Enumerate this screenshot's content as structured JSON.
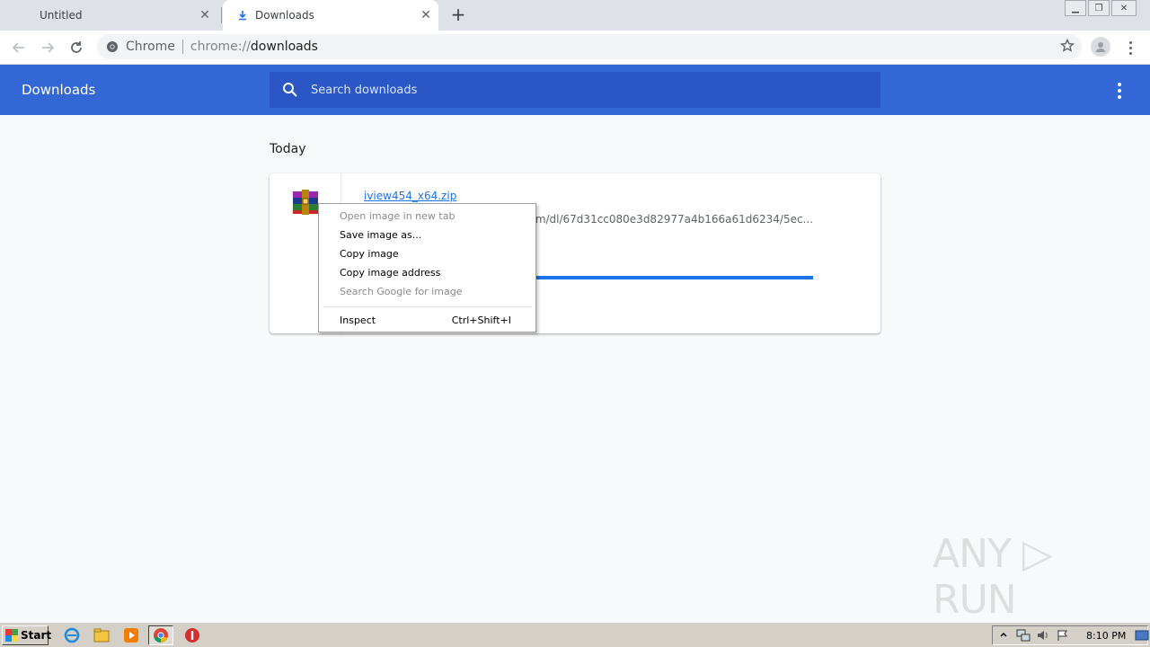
{
  "tabs": [
    {
      "label": "Untitled",
      "active": false
    },
    {
      "label": "Downloads",
      "active": true
    }
  ],
  "omnibox": {
    "chip_label": "Chrome",
    "url_scheme": "chrome://",
    "url_host": "downloads"
  },
  "downloads": {
    "title": "Downloads",
    "search_placeholder": "Search downloads",
    "section_label": "Today",
    "item": {
      "file_name": "iview454_x64.zip",
      "url": "com/dl/67d31cc080e3d82977a4b166a61d6234/5ec...",
      "progress": 1.0
    }
  },
  "context_menu": {
    "items": [
      {
        "label": "Open image in new tab",
        "disabled": true
      },
      {
        "label": "Save image as...",
        "disabled": false
      },
      {
        "label": "Copy image",
        "disabled": false
      },
      {
        "label": "Copy image address",
        "disabled": false
      },
      {
        "label": "Search Google for image",
        "disabled": true
      },
      {
        "label": "Inspect",
        "shortcut": "Ctrl+Shift+I",
        "disabled": false
      }
    ]
  },
  "watermark": "ANY RUN",
  "taskbar": {
    "start_label": "Start",
    "clock": "8:10 PM"
  },
  "colors": {
    "header_blue": "#3367d6",
    "search_blue": "#2a56c6",
    "link_blue": "#1a73e8"
  }
}
